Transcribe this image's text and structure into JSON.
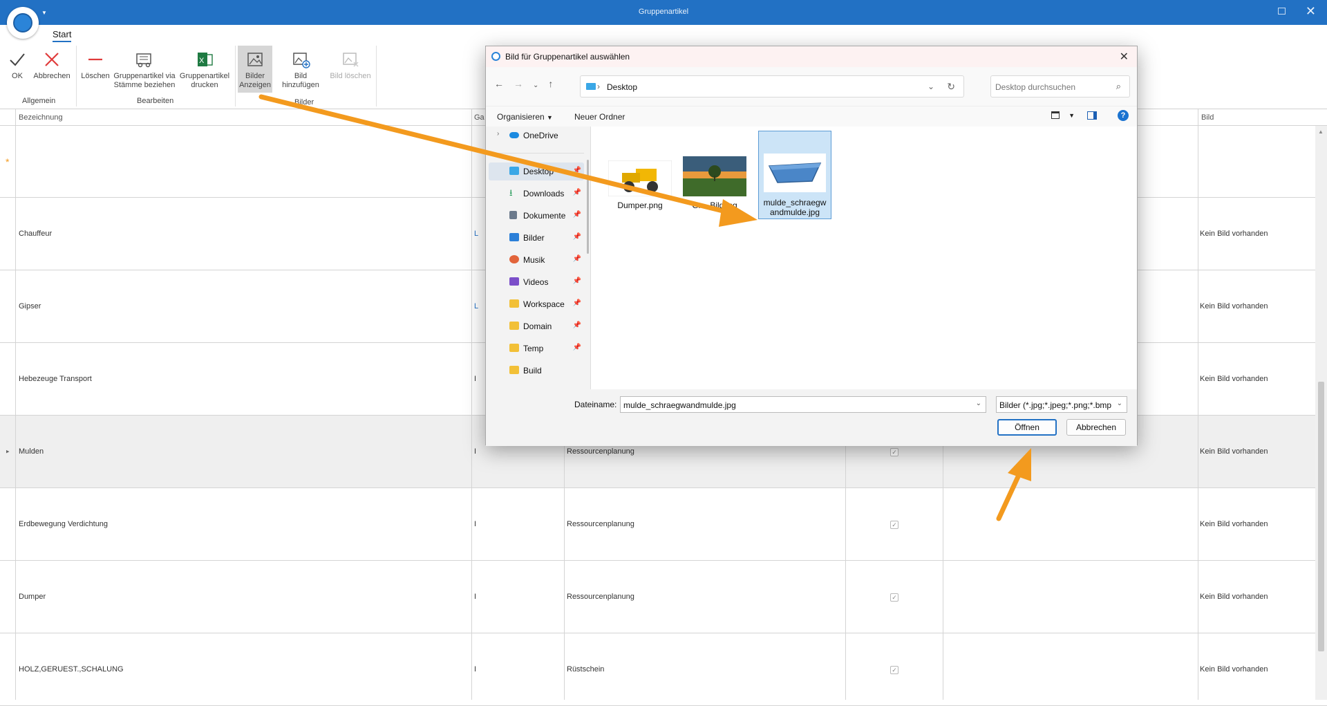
{
  "window": {
    "title": "Gruppenartikel"
  },
  "ribbon": {
    "tab": "Start",
    "buttons": {
      "ok": "OK",
      "cancel": "Abbrechen",
      "delete": "Löschen",
      "via_l1": "Gruppenartikel via",
      "via_l2": "Stämme beziehen",
      "print_l1": "Gruppenartikel",
      "print_l2": "drucken",
      "show_l1": "Bilder",
      "show_l2": "Anzeigen",
      "add_image": "Bild hinzufügen",
      "delete_image": "Bild löschen"
    },
    "groups": {
      "general": "Allgemein",
      "edit": "Bearbeiten",
      "images": "Bilder"
    }
  },
  "grid": {
    "headers": {
      "bezeichnung": "Bezeichnung",
      "ga": "Ga",
      "bild": "Bild"
    },
    "new_row_marker": "*",
    "rows": [
      {
        "name": "Chauffeur",
        "code": "L",
        "module": "",
        "bild": "Kein Bild vorhanden"
      },
      {
        "name": "Gipser",
        "code": "L",
        "module": "",
        "bild": "Kein Bild vorhanden"
      },
      {
        "name": "Hebezeuge Transport",
        "code": "I",
        "module": "",
        "bild": "Kein Bild vorhanden"
      },
      {
        "name": "Mulden",
        "code": "I",
        "module": "Ressourcenplanung",
        "bild": "Kein Bild vorhanden"
      },
      {
        "name": "Erdbewegung Verdichtung",
        "code": "I",
        "module": "Ressourcenplanung",
        "bild": "Kein Bild vorhanden"
      },
      {
        "name": "Dumper",
        "code": "I",
        "module": "Ressourcenplanung",
        "bild": "Kein Bild vorhanden"
      },
      {
        "name": "HOLZ,GERUEST.,SCHALUNG",
        "code": "I",
        "module": "Rüstschein",
        "bild": "Kein Bild vorhanden"
      }
    ]
  },
  "dialog": {
    "title": "Bild für Gruppenartikel auswählen",
    "address": "Desktop",
    "search_placeholder": "Desktop durchsuchen",
    "organize": "Organisieren",
    "new_folder": "Neuer Ordner",
    "nav": {
      "onedrive": "OneDrive",
      "items": [
        {
          "label": "Desktop",
          "color": "#3aa7e6"
        },
        {
          "label": "Downloads",
          "color": "#2a9d5c"
        },
        {
          "label": "Dokumente",
          "color": "#6b7a8c"
        },
        {
          "label": "Bilder",
          "color": "#2b7fd8"
        },
        {
          "label": "Musik",
          "color": "#e2643a"
        },
        {
          "label": "Videos",
          "color": "#7b4fc9"
        },
        {
          "label": "Workspace",
          "color": "#f2c037"
        },
        {
          "label": "Domain",
          "color": "#f2c037"
        },
        {
          "label": "Temp",
          "color": "#f2c037"
        },
        {
          "label": "Build",
          "color": "#f2c037"
        }
      ]
    },
    "files": [
      {
        "name": "Dumper.png"
      },
      {
        "name": "Gr... Bild.jpg"
      },
      {
        "name_l1": "mulde_schraegw",
        "name_l2": "andmulde.jpg"
      }
    ],
    "filename_label": "Dateiname:",
    "filename_value": "mulde_schraegwandmulde.jpg",
    "filetype": "Bilder (*.jpg;*.jpeg;*.png;*.bmp",
    "open": "Öffnen",
    "cancel": "Abbrechen"
  },
  "colors": {
    "titlebar": "#2271c4",
    "accent": "#f39a1e",
    "selection": "#cce4f7"
  }
}
